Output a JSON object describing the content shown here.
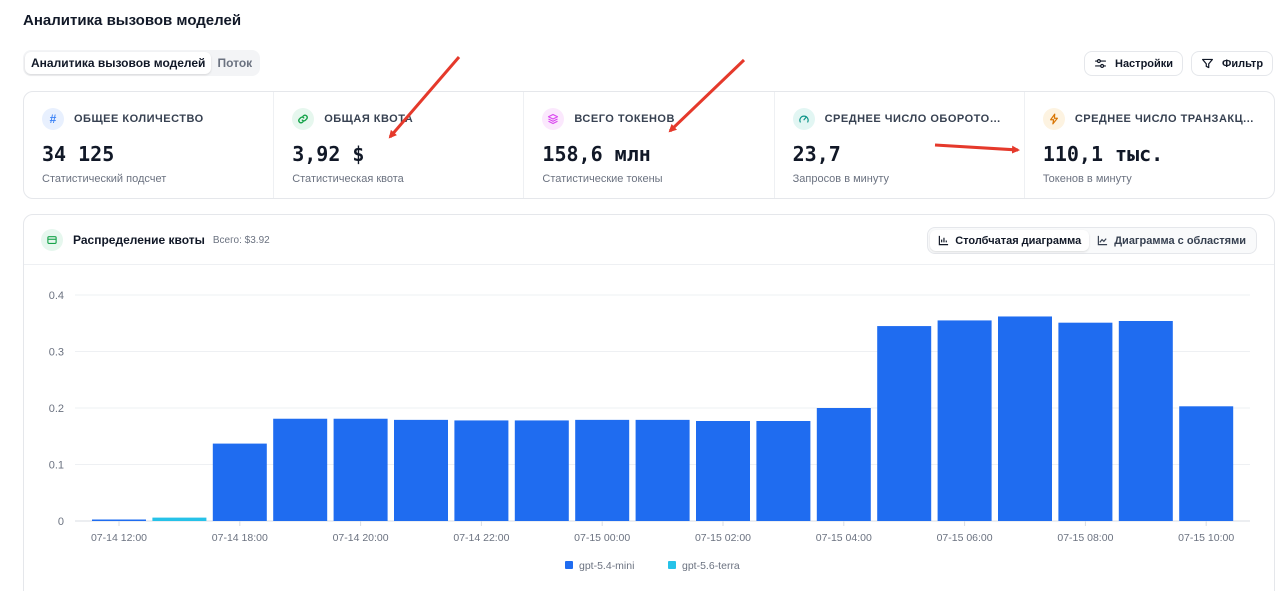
{
  "page": {
    "title": "Аналитика вызовов моделей"
  },
  "tabs": [
    {
      "label": "Аналитика вызовов моделей",
      "active": true
    },
    {
      "label": "Поток",
      "active": false
    }
  ],
  "toolbar": {
    "settings_label": "Настройки",
    "filter_label": "Фильтр"
  },
  "stats": [
    {
      "label": "ОБЩЕЕ КОЛИЧЕСТВО",
      "value": "34 125",
      "sub": "Статистический подсчет",
      "icon": "hash-icon",
      "color": "#3b82f6",
      "bg": "#e8f0fe"
    },
    {
      "label": "ОБЩАЯ КВОТА",
      "value": "3,92 $",
      "sub": "Статистическая квота",
      "icon": "link-icon",
      "color": "#16a34a",
      "bg": "#e6f7ee"
    },
    {
      "label": "ВСЕГО ТОКЕНОВ",
      "value": "158,6 млн",
      "sub": "Статистические токены",
      "icon": "layers-icon",
      "color": "#d946ef",
      "bg": "#fbe8fd"
    },
    {
      "label": "СРЕДНЕЕ ЧИСЛО ОБОРОТОВ ...",
      "value": "23,7",
      "sub": "Запросов в минуту",
      "icon": "gauge-icon",
      "color": "#0d9488",
      "bg": "#e2f6f3"
    },
    {
      "label": "СРЕДНЕЕ ЧИСЛО ТРАНЗАКЦ...",
      "value": "110,1 тыс.",
      "sub": "Токенов в минуту",
      "icon": "bolt-icon",
      "color": "#d97706",
      "bg": "#fdf3e1"
    }
  ],
  "chart_card": {
    "title": "Распределение квоты",
    "total": "Всего: $3.92",
    "bar_label": "Столбчатая диаграмма",
    "area_label": "Диаграмма с областями"
  },
  "colors": {
    "primary": "#1f6cf0",
    "secondary": "#26c2e8",
    "arrow": "#e5392b"
  },
  "chart_data": {
    "type": "bar",
    "stacked": true,
    "categories": [
      "07-14 12:00",
      "07-14 14:00",
      "07-14 18:00",
      "07-14 19:00",
      "07-14 20:00",
      "07-14 21:00",
      "07-14 22:00",
      "07-14 23:00",
      "07-15 00:00",
      "07-15 01:00",
      "07-15 02:00",
      "07-15 03:00",
      "07-15 04:00",
      "07-15 05:00",
      "07-15 06:00",
      "07-15 07:00",
      "07-15 08:00",
      "07-15 09:00",
      "07-15 10:00"
    ],
    "tick_labels": [
      "07-14 12:00",
      "07-14 18:00",
      "07-14 20:00",
      "07-14 22:00",
      "07-15 00:00",
      "07-15 02:00",
      "07-15 04:00",
      "07-15 06:00",
      "07-15 08:00",
      "07-15 10:00"
    ],
    "tick_category_index": [
      0,
      2,
      4,
      6,
      8,
      10,
      12,
      14,
      16,
      18
    ],
    "series": [
      {
        "name": "gpt-5.4-mini",
        "color": "#1f6cf0",
        "values": [
          0.002,
          0,
          0.137,
          0.181,
          0.181,
          0.179,
          0.178,
          0.178,
          0.179,
          0.179,
          0.177,
          0.177,
          0.2,
          0.345,
          0.355,
          0.362,
          0.351,
          0.354,
          0.203
        ]
      },
      {
        "name": "gpt-5.6-terra",
        "color": "#26c2e8",
        "values": [
          0,
          0.006,
          0,
          0,
          0,
          0,
          0,
          0,
          0,
          0,
          0,
          0,
          0,
          0,
          0,
          0,
          0,
          0,
          0
        ]
      }
    ],
    "y_ticks": [
      0,
      0.1,
      0.2,
      0.3,
      0.4
    ],
    "ylim": [
      0,
      0.4
    ],
    "grid": true,
    "legend_position": "bottom-center"
  }
}
